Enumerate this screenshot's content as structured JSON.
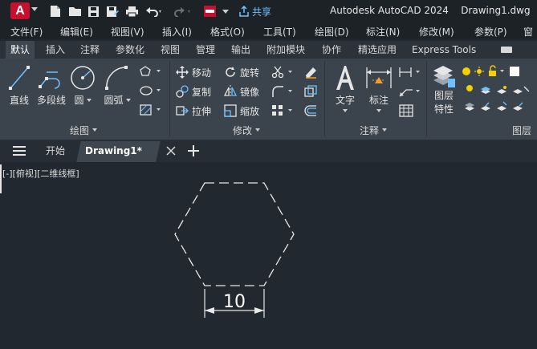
{
  "app": {
    "logo_letter": "A",
    "title": "Autodesk AutoCAD 2024",
    "filename": "Drawing1.dwg",
    "share_label": "共享"
  },
  "menu": [
    "文件(F)",
    "编辑(E)",
    "视图(V)",
    "插入(I)",
    "格式(O)",
    "工具(T)",
    "绘图(D)",
    "标注(N)",
    "修改(M)",
    "参数(P)",
    "窗"
  ],
  "ribbon_tabs": [
    "默认",
    "插入",
    "注释",
    "参数化",
    "视图",
    "管理",
    "输出",
    "附加模块",
    "协作",
    "精选应用",
    "Express Tools"
  ],
  "ribbon_active_tab": "默认",
  "draw_panel": {
    "title": "绘图",
    "line": "直线",
    "polyline": "多段线",
    "circle": "圆",
    "arc": "圆弧"
  },
  "modify_panel": {
    "title": "修改",
    "move": "移动",
    "rotate": "旋转",
    "copy": "复制",
    "mirror": "镜像",
    "stretch": "拉伸",
    "scale": "缩放"
  },
  "annotation_panel": {
    "title": "注释",
    "text": "文字",
    "dimension": "标注"
  },
  "layers_panel": {
    "title": "图层",
    "properties_line1": "图层",
    "properties_line2": "特性"
  },
  "doc_tabs": {
    "start": "开始",
    "active": "Drawing1*"
  },
  "viewport": {
    "controls": "[-][俯视][二维线框]"
  },
  "drawing": {
    "shape": "hexagon",
    "linetype": "dashed",
    "dimension_value": "10"
  },
  "colors": {
    "accent_blue": "#6ec1ff",
    "logo_red": "#c8102e",
    "canvas_bg": "#212830",
    "ribbon_bg": "#3b434c"
  }
}
